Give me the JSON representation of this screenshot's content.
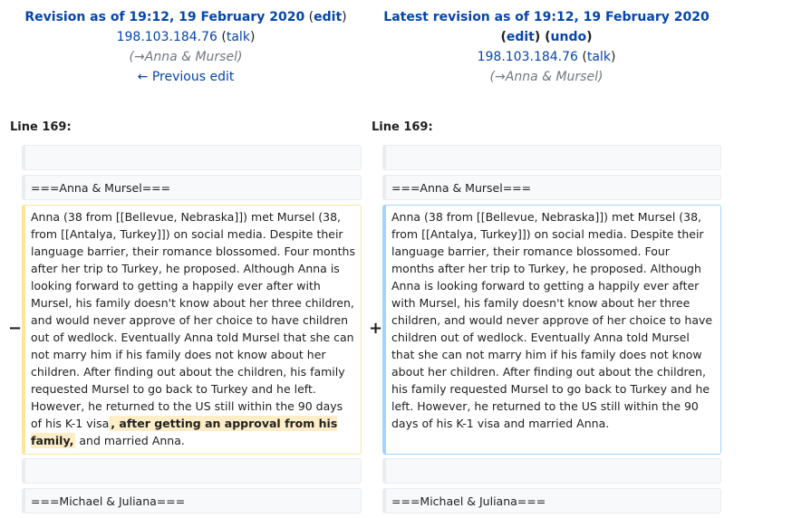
{
  "left_header": {
    "title": "Revision as of 19:12, 19 February 2020",
    "edit_label": "edit",
    "user": "198.103.184.76",
    "talk_label": "talk",
    "summary": "(→Anna & Mursel)",
    "prev_edit": "← Previous edit"
  },
  "right_header": {
    "title": "Latest revision as of 19:12, 19 February 2020",
    "edit_label": "edit",
    "undo_label": "undo",
    "user": "198.103.184.76",
    "talk_label": "talk",
    "summary": "(→Anna & Mursel)"
  },
  "line_labels": {
    "left": "Line 169:",
    "right": "Line 169:"
  },
  "markers": {
    "minus": "−",
    "plus": "+"
  },
  "context": {
    "empty": "",
    "anna_heading": "===Anna & Mursel===",
    "michael_heading": "===Michael & Juliana==="
  },
  "deleted": {
    "text_before": "Anna (38 from [[Bellevue, Nebraska]]) met Mursel (38, from [[Antalya, Turkey]]) on social media. Despite their language barrier, their romance blossomed. Four months after her trip to Turkey, he proposed. Although Anna is looking forward to getting a happily ever after with Mursel, his family doesn't know about her three children, and would never approve of her choice to have children out of wedlock. Eventually Anna told Mursel that she can not marry him if his family does not know about her children.  After finding out about the children, his family requested Mursel to go back to Turkey and he left. However, he returned to the US still within the 90 days of his K-1 visa",
    "highlight": ", after getting an approval from his family,",
    "text_after": " and married Anna."
  },
  "added": {
    "text": "Anna (38 from [[Bellevue, Nebraska]]) met Mursel (38, from [[Antalya, Turkey]]) on social media. Despite their language barrier, their romance blossomed. Four months after her trip to Turkey, he proposed. Although Anna is looking forward to getting a happily ever after with Mursel, his family doesn't know about her three children, and would never approve of her choice to have children out of wedlock. Eventually Anna told Mursel that she can not marry him if his family does not know about her children.  After finding out about the children, his family requested Mursel to go back to Turkey and he left. However, he returned to the US still within the 90 days of his K-1 visa and married Anna."
  },
  "colors": {
    "link": "#0645ad",
    "deleted_border": "#ffe49c",
    "added_border": "#a3d3ff",
    "highlight_bg": "#feeec8",
    "context_bg": "#f8f9fa"
  }
}
